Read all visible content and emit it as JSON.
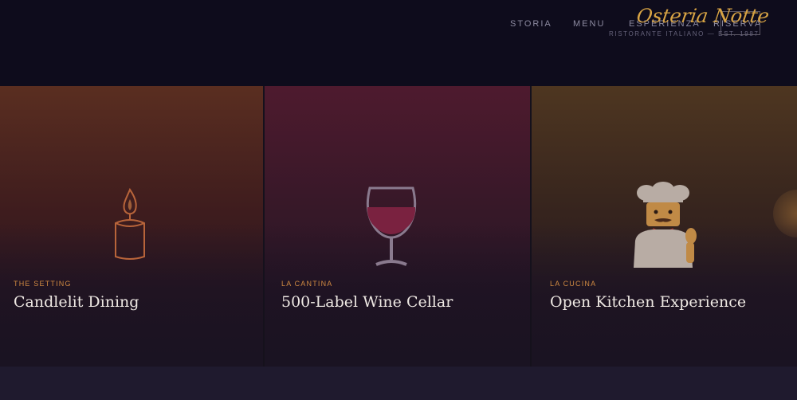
{
  "nav": {
    "items": [
      "STORIA",
      "MENU",
      "ESPERIENZA",
      "RISERVA"
    ]
  },
  "logo": {
    "script": "Osteria Notte",
    "tagline": "RISTORANTE ITALIANO — EST. 1987"
  },
  "cards": [
    {
      "eyebrow": "THE SETTING",
      "title": "Candlelit Dining",
      "icon": "candle-icon"
    },
    {
      "eyebrow": "LA CANTINA",
      "title": "500-Label Wine Cellar",
      "icon": "wine-glass-icon"
    },
    {
      "eyebrow": "LA CUCINA",
      "title": "Open Kitchen Experience",
      "icon": "chef-icon"
    }
  ],
  "colors": {
    "background": "#0e0c1c",
    "accent_gold": "#d8a444",
    "eyebrow": "#d08a42",
    "title": "#efe9e4"
  }
}
